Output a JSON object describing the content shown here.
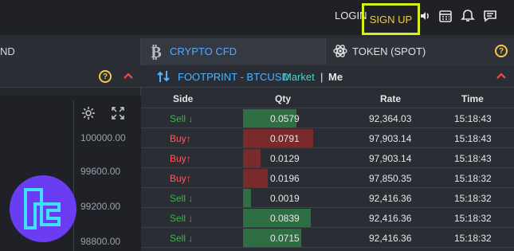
{
  "topbar": {
    "login": "LOGIN",
    "signup": "SIGN UP"
  },
  "tabs": {
    "left_partial": "ND",
    "crypto_cfd": "CRYPTO CFD",
    "token_spot": "TOKEN (SPOT)"
  },
  "left_panel": {
    "price_ticks": [
      "100000.00",
      "99600.00",
      "99200.00",
      "98800.00"
    ]
  },
  "footprint": {
    "title": "FOOTPRINT - BTCUSD",
    "market_label": "Market",
    "separator": "|",
    "me_label": "Me"
  },
  "table": {
    "columns": {
      "side": "Side",
      "qty": "Qty",
      "rate": "Rate",
      "time": "Time"
    },
    "rows": [
      {
        "side": "Sell",
        "qty": "0.0579",
        "rate": "92,364.03",
        "time": "15:18:43",
        "fill": 0.55,
        "color": "#2f6e43"
      },
      {
        "side": "Buy",
        "qty": "0.0791",
        "rate": "97,903.14",
        "time": "15:18:43",
        "fill": 0.72,
        "color": "#7a2a2a"
      },
      {
        "side": "Buy",
        "qty": "0.0129",
        "rate": "97,903.14",
        "time": "15:18:43",
        "fill": 0.18,
        "color": "#7a2a2a"
      },
      {
        "side": "Buy",
        "qty": "0.0196",
        "rate": "97,850.35",
        "time": "15:18:32",
        "fill": 0.25,
        "color": "#7a2a2a"
      },
      {
        "side": "Sell",
        "qty": "0.0019",
        "rate": "92,416.36",
        "time": "15:18:32",
        "fill": 0.08,
        "color": "#2f6e43"
      },
      {
        "side": "Sell",
        "qty": "0.0839",
        "rate": "92,416.36",
        "time": "15:18:32",
        "fill": 0.7,
        "color": "#2f6e43"
      },
      {
        "side": "Sell",
        "qty": "0.0715",
        "rate": "92,416.36",
        "time": "15:18:32",
        "fill": 0.6,
        "color": "#2f6e43"
      }
    ]
  }
}
